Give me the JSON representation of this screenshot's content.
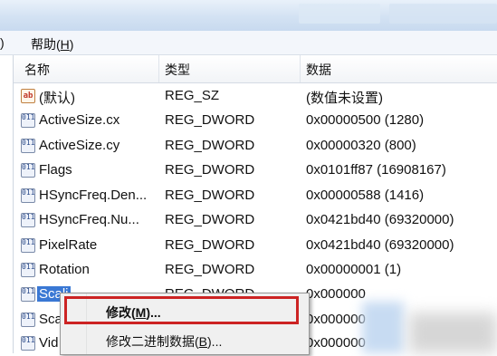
{
  "menu": {
    "partial_label": ")",
    "help_label_prefix": "帮助(",
    "help_label_key": "H",
    "help_label_suffix": ")"
  },
  "columns": {
    "name": "名称",
    "type": "类型",
    "data": "数据"
  },
  "rows": [
    {
      "icon": "string-value-icon",
      "icon_text": "ab",
      "name": "(默认)",
      "type": "REG_SZ",
      "data": "(数值未设置)"
    },
    {
      "icon": "binary-value-icon",
      "icon_text": "011",
      "name": "ActiveSize.cx",
      "type": "REG_DWORD",
      "data": "0x00000500 (1280)"
    },
    {
      "icon": "binary-value-icon",
      "icon_text": "011",
      "name": "ActiveSize.cy",
      "type": "REG_DWORD",
      "data": "0x00000320 (800)"
    },
    {
      "icon": "binary-value-icon",
      "icon_text": "011",
      "name": "Flags",
      "type": "REG_DWORD",
      "data": "0x0101ff87 (16908167)"
    },
    {
      "icon": "binary-value-icon",
      "icon_text": "011",
      "name": "HSyncFreq.Den...",
      "type": "REG_DWORD",
      "data": "0x00000588 (1416)"
    },
    {
      "icon": "binary-value-icon",
      "icon_text": "011",
      "name": "HSyncFreq.Nu...",
      "type": "REG_DWORD",
      "data": "0x0421bd40 (69320000)"
    },
    {
      "icon": "binary-value-icon",
      "icon_text": "011",
      "name": "PixelRate",
      "type": "REG_DWORD",
      "data": "0x0421bd40 (69320000)"
    },
    {
      "icon": "binary-value-icon",
      "icon_text": "011",
      "name": "Rotation",
      "type": "REG_DWORD",
      "data": "0x00000001 (1)"
    },
    {
      "icon": "binary-value-icon",
      "icon_text": "011",
      "name": "Scali",
      "type": "REG_DWORD",
      "data": "0x000000"
    },
    {
      "icon": "binary-value-icon",
      "icon_text": "011",
      "name": "Sca",
      "type": "",
      "data": "0x000000"
    },
    {
      "icon": "binary-value-icon",
      "icon_text": "011",
      "name": "Vid",
      "type": "",
      "data": "0x000000"
    }
  ],
  "context_menu": {
    "modify_prefix": "修改(",
    "modify_key": "M",
    "modify_suffix": ")...",
    "modify_binary_prefix": "修改二进制数据(",
    "modify_binary_key": "B",
    "modify_binary_suffix": ")..."
  },
  "colors": {
    "highlight_border": "#cc2323",
    "selection": "#3a78d4"
  }
}
